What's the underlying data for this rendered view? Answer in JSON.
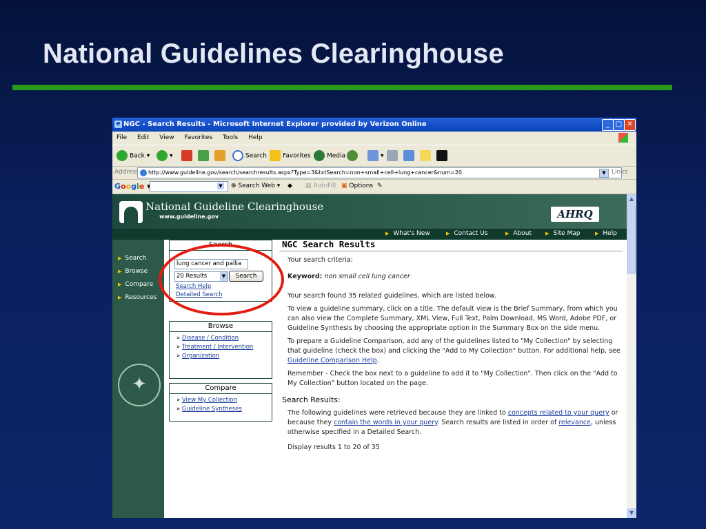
{
  "slide": {
    "title": "National Guidelines Clearinghouse"
  },
  "browser": {
    "title": "NGC - Search Results - Microsoft Internet Explorer provided by Verizon Online",
    "menu": [
      "File",
      "Edit",
      "View",
      "Favorites",
      "Tools",
      "Help"
    ],
    "toolbar": {
      "back": "Back",
      "search": "Search",
      "favorites": "Favorites",
      "media": "Media"
    },
    "address_label": "Address",
    "address_url": "http://www.guideline.gov/search/searchresults.aspx?Type=3&txtSearch=non+small+cell+lung+cancer&num=20",
    "links_label": "Links",
    "google": {
      "logo": "Google",
      "search_web": "Search Web",
      "autofill": "AutoFill",
      "options": "Options"
    }
  },
  "site": {
    "name": "National Guideline Clearinghouse",
    "url": "www.guideline.gov",
    "agency_logo": "AHRQ",
    "topnav": [
      "What's New",
      "Contact Us",
      "About",
      "Site Map",
      "Help"
    ],
    "sidenav": [
      "Search",
      "Browse",
      "Compare",
      "Resources"
    ]
  },
  "search_box": {
    "header": "Search",
    "input_value": "lung cancer and pallia",
    "results_option": "20 Results",
    "button": "Search",
    "help_link": "Search Help",
    "detailed_link": "Detailed Search"
  },
  "browse_box": {
    "header": "Browse",
    "items": [
      "Disease / Condition",
      "Treatment / Intervention",
      "Organization"
    ]
  },
  "compare_box": {
    "header": "Compare",
    "items": [
      "View My Collection",
      "Guideline Syntheses"
    ]
  },
  "results": {
    "title": "NGC Search Results",
    "criteria_label": "Your search criteria:",
    "keyword_label": "Keyword:",
    "keyword_value": "non small cell lung cancer",
    "found_text": "Your search found 35 related guidelines, which are listed below.",
    "view_text": "To view a guideline summary, click on a title. The default view is the Brief Summary, from which you can also view the Complete Summary, XML View, Full Text, Palm Download, MS Word, Adobe PDF, or Guideline Synthesis by choosing the appropriate option in the Summary Box on the side menu.",
    "compare_text_1": "To prepare a Guideline Comparison, add any of the guidelines listed to \"My Collection\" by selecting that guideline (check the box) and clicking the \"Add to My Collection\" button. For additional help, see ",
    "compare_link": "Guideline Comparison Help",
    "compare_text_2": ".",
    "remember_text": "Remember - Check the box next to a guideline to add it to \"My Collection\". Then click on the \"Add to My Collection\" button located on the page.",
    "section_title": "Search Results:",
    "retrieved_1": "The following guidelines were retrieved because they are linked to ",
    "retrieved_link_1": "concepts related to your query",
    "retrieved_2": " or because they ",
    "retrieved_link_2": "contain the words in your query",
    "retrieved_3": ". Search results are listed in order of ",
    "retrieved_link_3": "relevance",
    "retrieved_4": ", unless otherwise specified in a Detailed Search.",
    "display_text": "Display results 1 to 20 of 35"
  }
}
